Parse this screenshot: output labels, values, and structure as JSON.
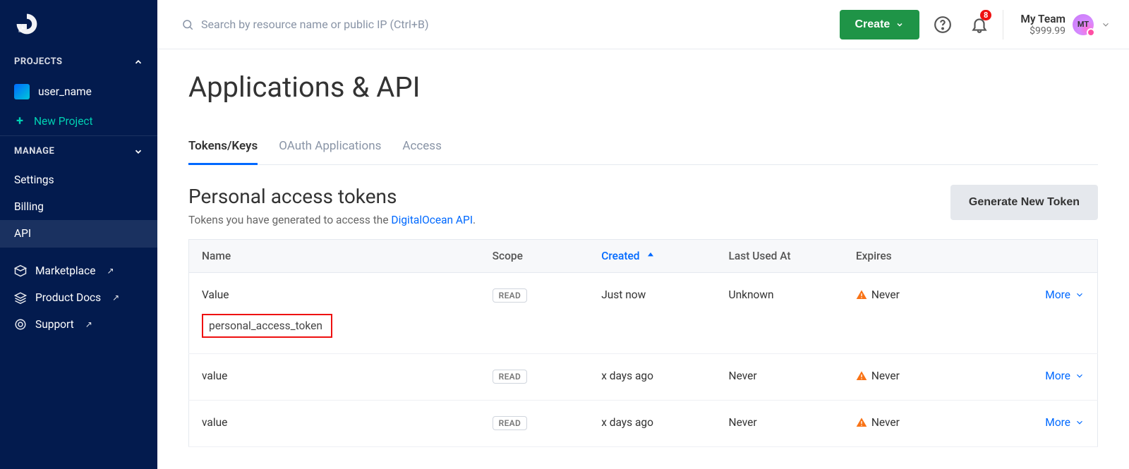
{
  "header": {
    "search_placeholder": "Search by resource name or public IP (Ctrl+B)",
    "create_label": "Create",
    "notification_count": "8",
    "team_name": "My Team",
    "team_balance": "$999.99",
    "avatar_initials": "MT"
  },
  "sidebar": {
    "projects_header": "PROJECTS",
    "project_name": "user_name",
    "new_project": "New Project",
    "manage_header": "MANAGE",
    "items": {
      "settings": "Settings",
      "billing": "Billing",
      "api": "API"
    },
    "links": {
      "marketplace": "Marketplace",
      "product_docs": "Product Docs",
      "support": "Support"
    }
  },
  "page": {
    "title": "Applications & API",
    "tabs": {
      "tokens": "Tokens/Keys",
      "oauth": "OAuth Applications",
      "access": "Access"
    },
    "section_title": "Personal access tokens",
    "section_sub_prefix": "Tokens you have generated to access the ",
    "section_sub_link": "DigitalOcean API",
    "section_sub_suffix": ".",
    "generate_button": "Generate New Token"
  },
  "table": {
    "headers": {
      "name": "Name",
      "scope": "Scope",
      "created": "Created",
      "last_used": "Last Used At",
      "expires": "Expires",
      "more": "More"
    },
    "rows": [
      {
        "name": "Value",
        "scope": "READ",
        "created": "Just now",
        "last_used": "Unknown",
        "expires": "Never",
        "token": "personal_access_token"
      },
      {
        "name": "value",
        "scope": "READ",
        "created": "x days ago",
        "last_used": "Never",
        "expires": "Never"
      },
      {
        "name": "value",
        "scope": "READ",
        "created": "x days ago",
        "last_used": "Never",
        "expires": "Never"
      }
    ]
  }
}
